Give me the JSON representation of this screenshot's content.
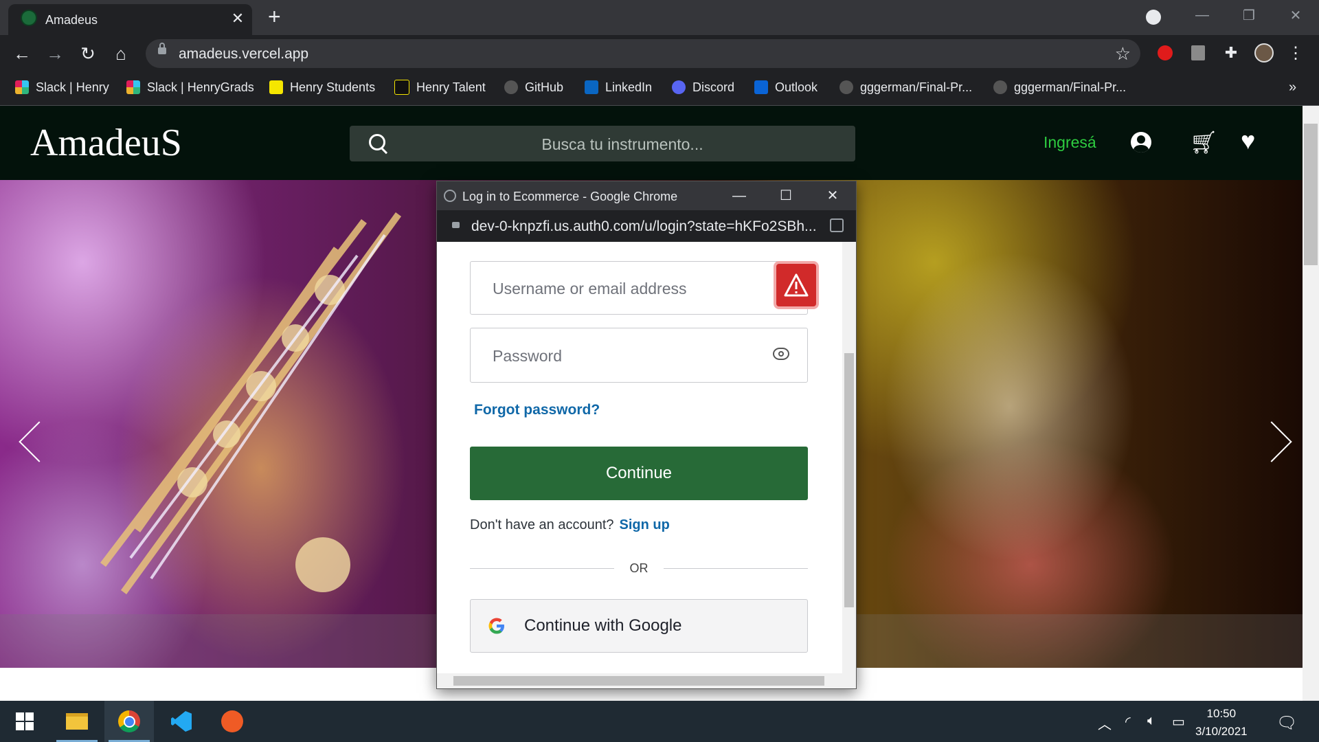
{
  "browser": {
    "tab_title": "Amadeus",
    "url": "amadeus.vercel.app",
    "bookmarks": [
      "Slack | Henry",
      "Slack | HenryGrads",
      "Henry Students",
      "Henry Talent",
      "GitHub",
      "LinkedIn",
      "Discord",
      "Outlook",
      "gggerman/Final-Pr...",
      "gggerman/Final-Pr..."
    ],
    "bookmarks_overflow": "»"
  },
  "header": {
    "logo": "AmadeuS",
    "search_placeholder": "Busca tu instrumento...",
    "login_label": "Ingresá"
  },
  "popup": {
    "title": "Log in to Ecommerce - Google Chrome",
    "url": "dev-0-knpzfi.us.auth0.com/u/login?state=hKFo2SBh...",
    "username_placeholder": "Username or email address",
    "password_placeholder": "Password",
    "forgot_label": "Forgot password?",
    "continue_label": "Continue",
    "no_account_text": "Don't have an account?",
    "signup_label": "Sign up",
    "or_text": "OR",
    "google_label": "Continue with Google"
  },
  "taskbar": {
    "time": "10:50",
    "date": "3/10/2021"
  },
  "colors": {
    "accent_green": "#2ecc40",
    "continue_green": "#276a37",
    "link_blue": "#1068a8",
    "warning_red": "#d12a2a"
  }
}
